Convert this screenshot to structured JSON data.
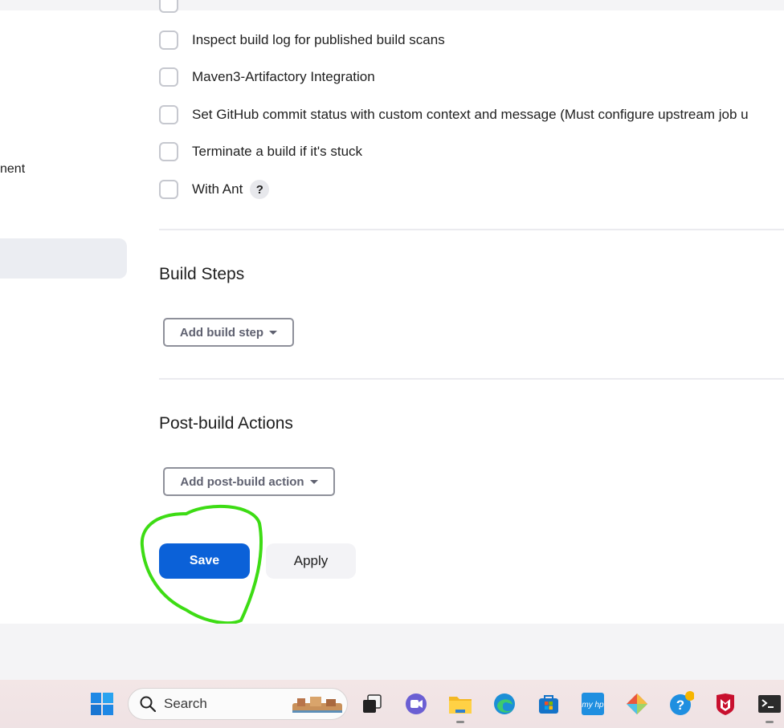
{
  "sidebar": {
    "partial_text": "nent"
  },
  "options": [
    {
      "label": "Inspect build log for published build scans"
    },
    {
      "label": "Maven3-Artifactory Integration"
    },
    {
      "label": "Set GitHub commit status with custom context and message (Must configure upstream job u"
    },
    {
      "label": "Terminate a build if it's stuck"
    },
    {
      "label": "With Ant",
      "help": "?"
    }
  ],
  "sections": {
    "build_steps": {
      "title": "Build Steps",
      "button": "Add build step"
    },
    "post_build": {
      "title": "Post-build Actions",
      "button": "Add post-build action"
    }
  },
  "actions": {
    "save": "Save",
    "apply": "Apply"
  },
  "taskbar": {
    "search_label": "Search",
    "icons": [
      "windows-start",
      "search",
      "task-view",
      "teams-chat",
      "file-explorer",
      "edge",
      "microsoft-store",
      "myhp",
      "git",
      "help",
      "mcafee",
      "terminal"
    ]
  },
  "colors": {
    "primary": "#0b61d8",
    "annotation": "#3ddc14"
  }
}
